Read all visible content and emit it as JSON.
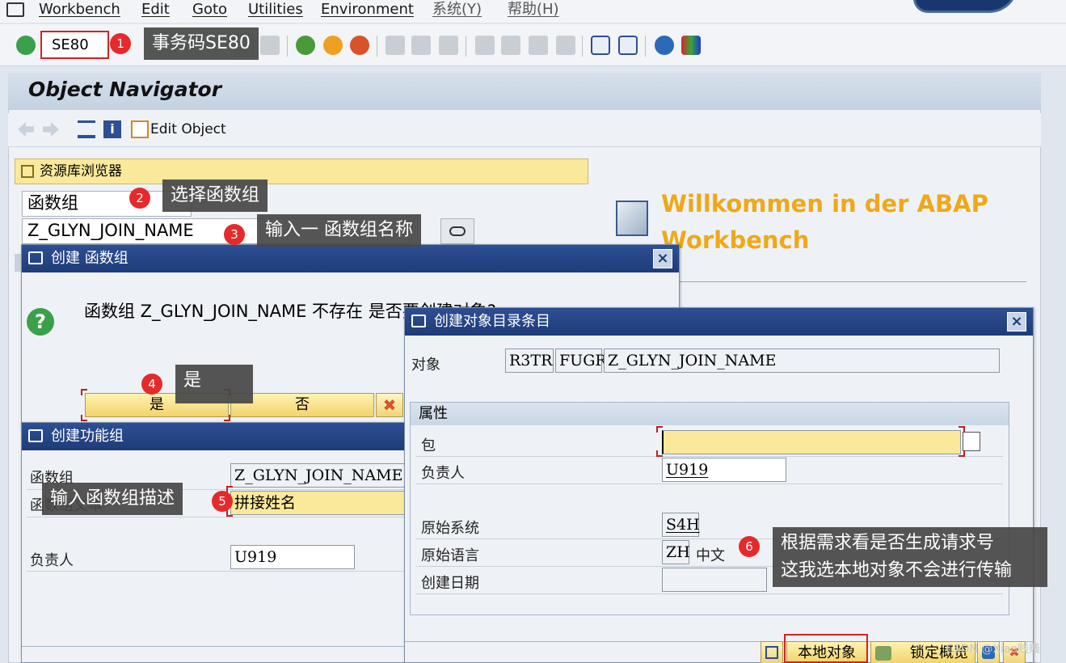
{
  "menu": {
    "items": [
      "Workbench",
      "Edit",
      "Goto",
      "Utilities",
      "Environment",
      "系统(Y)",
      "帮助(H)"
    ]
  },
  "toolbar": {
    "command_value": "SE80"
  },
  "callouts": {
    "c1": {
      "num": "1",
      "text": "事务码SE80"
    },
    "c2": {
      "num": "2",
      "text": "选择函数组"
    },
    "c3": {
      "num": "3",
      "text": "输入一 函数组名称"
    },
    "c4": {
      "num": "4",
      "text": "是"
    },
    "c5": {
      "num": "5",
      "text": "输入函数组描述"
    },
    "c6": {
      "num": "6",
      "line1": "根据需求看是否生成请求号",
      "line2": "这我选本地对象不会进行传输"
    }
  },
  "main": {
    "title": "Object Navigator",
    "edit_object": "Edit Object",
    "repo_browser": "资源库浏览器",
    "object_type": "函数组",
    "object_name": "Z_GLYN_JOIN_NAME",
    "welcome": "Willkommen in der ABAP Workbench"
  },
  "dlg_create": {
    "title": "创建 函数组",
    "question": "函数组 Z_GLYN_JOIN_NAME 不存在 是否要创建对象?",
    "yes": "是",
    "no": "否"
  },
  "dlg_fg": {
    "title": "创建功能组",
    "label_fg": "函数组",
    "value_fg": "Z_GLYN_JOIN_NAME",
    "label_desc": "函数组文本",
    "value_desc": "拼接姓名",
    "label_owner": "负责人",
    "value_owner": "U919"
  },
  "dlg_obj": {
    "title": "创建对象目录条目",
    "label_object": "对象",
    "pgmid": "R3TR",
    "objtype": "FUGR",
    "objname": "Z_GLYN_JOIN_NAME",
    "attr_title": "属性",
    "label_package": "包",
    "value_package": "",
    "label_owner": "负责人",
    "value_owner": "U919",
    "label_origsys": "原始系统",
    "value_origsys": "S4H",
    "label_origlang": "原始语言",
    "value_origlang": "ZH",
    "value_lang_text": "中文",
    "label_date": "创建日期",
    "value_date": "",
    "btn_local": "本地对象",
    "btn_lock": "锁定概览"
  },
  "watermark": "CSDN @Xiao贱贱"
}
